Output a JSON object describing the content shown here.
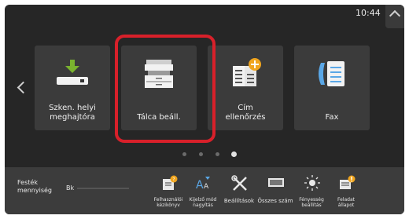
{
  "status": {
    "time": "10:44"
  },
  "tiles": [
    {
      "label": "Szken. helyi\nmeghajtóra",
      "icon": "usb-drive-download-icon"
    },
    {
      "label": "Tálca beáll.",
      "icon": "printer-copier-icon"
    },
    {
      "label": "Cím\nellenőrzés",
      "icon": "address-book-add-icon"
    },
    {
      "label": "Fax",
      "icon": "fax-phone-icon"
    }
  ],
  "pager": {
    "count": 4,
    "active": 3
  },
  "toner": {
    "label": "Festék\nmennyiség",
    "color_label": "Bk",
    "level": 0.0
  },
  "quick": [
    {
      "label": "Felhasználói\nkézikönyv",
      "icon": "manual-icon"
    },
    {
      "label": "Kijelző mód\nnagyítás",
      "icon": "text-zoom-icon"
    },
    {
      "label": "Beállítások",
      "icon": "settings-tools-icon"
    },
    {
      "label": "Összes szám",
      "icon": "counter-icon"
    },
    {
      "label": "Fényesség\nbeállítás",
      "icon": "brightness-icon"
    },
    {
      "label": "Feladat\nállapot",
      "icon": "job-status-icon"
    }
  ],
  "colors": {
    "highlight": "#d8202a",
    "accent_orange": "#f0a51e",
    "accent_green": "#7ab32e",
    "accent_blue": "#5aa7e6"
  }
}
